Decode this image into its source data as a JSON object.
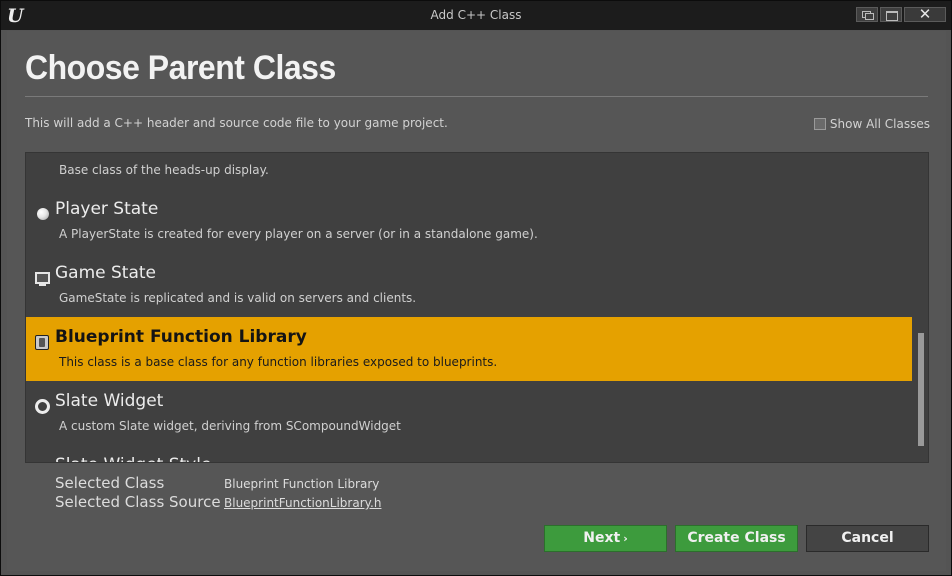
{
  "window": {
    "title": "Add C++ Class",
    "logo_text": "U",
    "close_symbol": "✕"
  },
  "header": {
    "title": "Choose Parent Class",
    "description": "This will add a C++ header and source code file to your game project."
  },
  "show_all": {
    "label": "Show All Classes",
    "checked": false
  },
  "classes": [
    {
      "name": "",
      "description": "Base class of the heads-up display.",
      "icon": "hud-icon",
      "selected": false
    },
    {
      "name": "Player State",
      "description": "A PlayerState is created for every player on a server (or in a standalone game).",
      "icon": "sphere-icon",
      "selected": false
    },
    {
      "name": "Game State",
      "description": "GameState is replicated and is valid on servers and clients.",
      "icon": "monitor-icon",
      "selected": false
    },
    {
      "name": "Blueprint Function Library",
      "description": "This class is a base class for any function libraries exposed to blueprints.",
      "icon": "book-icon",
      "selected": true
    },
    {
      "name": "Slate Widget",
      "description": "A custom Slate widget, deriving from SCompoundWidget",
      "icon": "ring-icon",
      "selected": false
    },
    {
      "name": "Slate Widget Style",
      "description": "",
      "icon": "ring-icon",
      "selected": false
    }
  ],
  "selection": {
    "class_label": "Selected Class",
    "class_value": "Blueprint Function Library",
    "source_label": "Selected Class Source",
    "source_value": "BlueprintFunctionLibrary.h"
  },
  "buttons": {
    "next": "Next",
    "next_chevron": "›",
    "create": "Create Class",
    "cancel": "Cancel"
  },
  "colors": {
    "selected_row": "#e5a100",
    "primary_button": "#3d9b3d"
  }
}
